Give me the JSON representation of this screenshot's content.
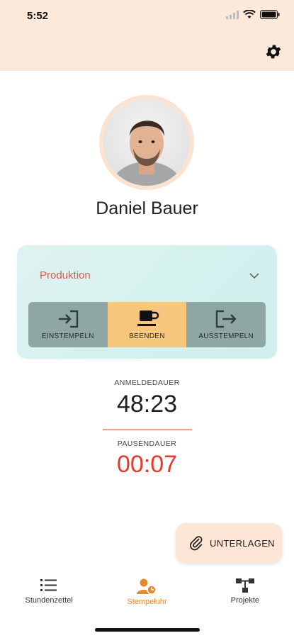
{
  "status_bar": {
    "time": "5:52"
  },
  "profile": {
    "name": "Daniel Bauer"
  },
  "card": {
    "project": "Produktion",
    "actions": [
      {
        "label": "EINSTEMPELN"
      },
      {
        "label": "BEENDEN"
      },
      {
        "label": "AUSSTEMPELN"
      }
    ]
  },
  "metrics": {
    "login_caption": "ANMELDEDAUER",
    "login_value": "48:23",
    "pause_caption": "PAUSENDAUER",
    "pause_value": "00:07"
  },
  "documents_button": {
    "label": "UNTERLAGEN"
  },
  "bottom_nav": [
    {
      "label": "Stundenzettel"
    },
    {
      "label": "Stempeluhr"
    },
    {
      "label": "Projekte"
    }
  ],
  "colors": {
    "header_bg": "#fde9da",
    "accent_orange": "#e58a2b",
    "project_red": "#e05b4b",
    "pause_red": "#e23b2e",
    "card_bg": "#d3f1ee",
    "action_active": "#f8c77e",
    "action_inactive": "#8fa7a3"
  }
}
